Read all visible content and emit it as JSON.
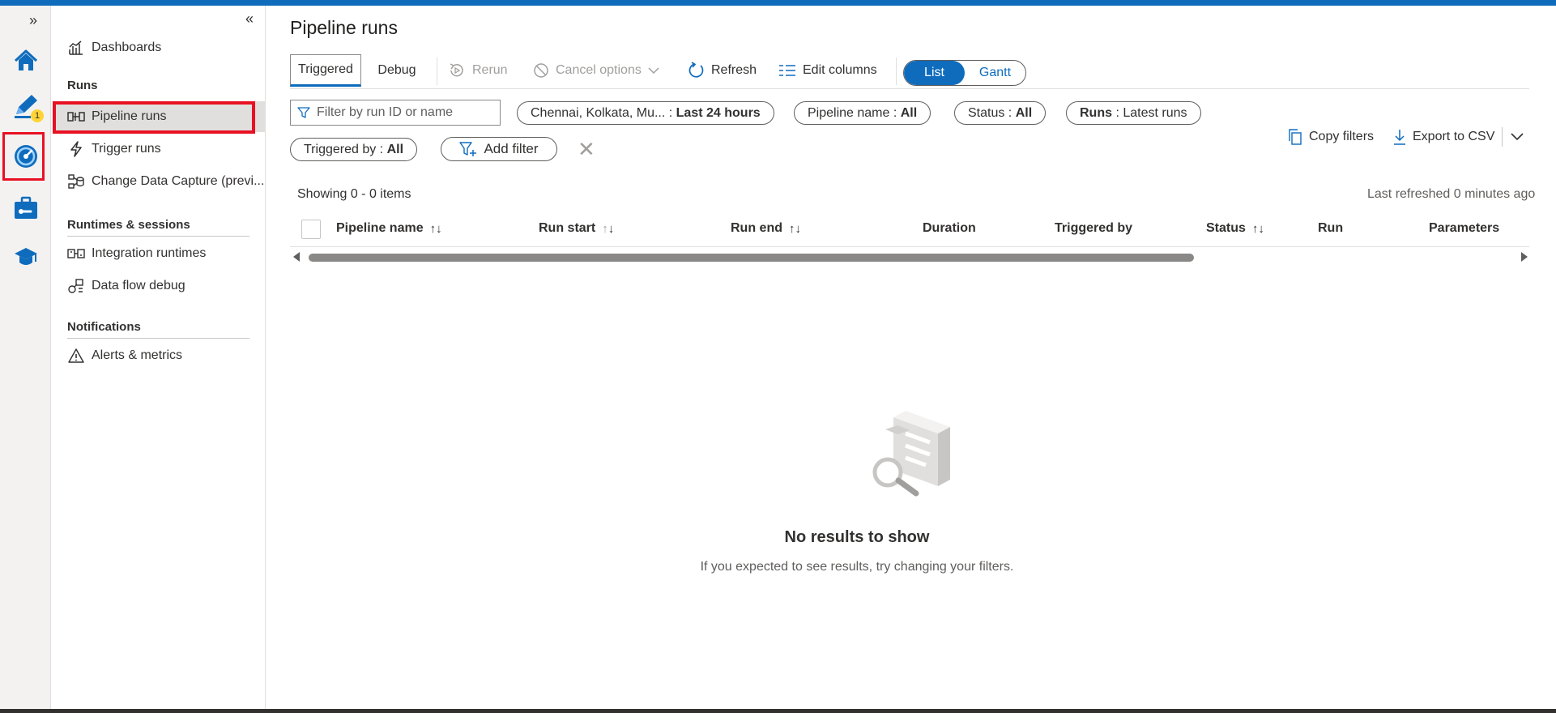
{
  "colors": {
    "accent": "#0f6cbd",
    "highlight": "#e81123",
    "badge": "#ffd335"
  },
  "rail": {
    "expand_icon": "double-chevron-right-icon",
    "items": [
      {
        "name": "home-icon"
      },
      {
        "name": "author-pencil-icon",
        "badge": "1"
      },
      {
        "name": "monitor-gauge-icon"
      },
      {
        "name": "manage-toolbox-icon"
      },
      {
        "name": "learning-center-icon"
      }
    ]
  },
  "nav": {
    "collapse_icon": "double-chevron-left-icon",
    "dashboards": "Dashboards",
    "runs_section": "Runs",
    "pipeline_runs": "Pipeline runs",
    "trigger_runs": "Trigger runs",
    "change_data_capture": "Change Data Capture (previ...",
    "runtimes_section": "Runtimes & sessions",
    "integration_runtimes": "Integration runtimes",
    "data_flow_debug": "Data flow debug",
    "notifications_section": "Notifications",
    "alerts_metrics": "Alerts & metrics"
  },
  "main": {
    "title": "Pipeline runs",
    "tabs": {
      "triggered": "Triggered",
      "debug": "Debug"
    },
    "toolbar": {
      "rerun": "Rerun",
      "cancel_options": "Cancel options",
      "refresh": "Refresh",
      "edit_columns": "Edit columns",
      "view_list": "List",
      "view_gantt": "Gantt"
    },
    "filters": {
      "search_placeholder": "Filter by run ID or name",
      "timezone_label": "Chennai, Kolkata, Mu... :",
      "timezone_value": "Last 24 hours",
      "pipeline_name_label": "Pipeline name :",
      "pipeline_name_value": "All",
      "status_label": "Status :",
      "status_value": "All",
      "runs_label": "Runs",
      "runs_value": ": Latest runs",
      "triggered_by_label": "Triggered by :",
      "triggered_by_value": "All",
      "add_filter": "Add filter",
      "copy_filters": "Copy filters",
      "export_csv": "Export to CSV"
    },
    "showing": "Showing 0 - 0 items",
    "last_refreshed": "Last refreshed 0 minutes ago",
    "columns": {
      "pipeline_name": "Pipeline name",
      "run_start": "Run start",
      "run_end": "Run end",
      "duration": "Duration",
      "triggered_by": "Triggered by",
      "status": "Status",
      "run": "Run",
      "parameters": "Parameters"
    },
    "empty": {
      "title": "No results to show",
      "subtitle": "If you expected to see results, try changing your filters."
    }
  }
}
